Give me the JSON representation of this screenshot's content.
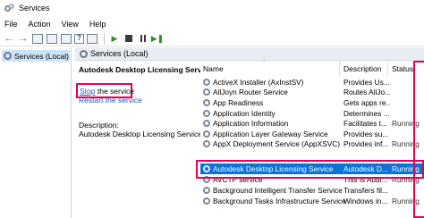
{
  "window": {
    "title": "Services"
  },
  "menu": [
    "File",
    "Action",
    "View",
    "Help"
  ],
  "tree": {
    "item": "Services (Local)"
  },
  "header": {
    "title": "Services (Local)"
  },
  "detail": {
    "service_title": "Autodesk Desktop Licensing Service",
    "stop_link": "Stop",
    "stop_suffix": " the service",
    "restart_link": "Restart the service",
    "desc_label": "Description:",
    "desc_text": "Autodesk Desktop Licensing Service"
  },
  "columns": {
    "name": "Name",
    "description": "Description",
    "status": "Status"
  },
  "rows": [
    {
      "name": "ActiveX Installer (AxInstSV)",
      "desc": "Provides Us...",
      "status": ""
    },
    {
      "name": "AllJoyn Router Service",
      "desc": "Routes AllJo...",
      "status": ""
    },
    {
      "name": "App Readiness",
      "desc": "Gets apps re...",
      "status": ""
    },
    {
      "name": "Application Identity",
      "desc": "Determines ...",
      "status": ""
    },
    {
      "name": "Application Information",
      "desc": "Facilitates t...",
      "status": "Running"
    },
    {
      "name": "Application Layer Gateway Service",
      "desc": "Provides su...",
      "status": ""
    },
    {
      "name": "AppX Deployment Service (AppXSVC)",
      "desc": "Provides inf...",
      "status": "Running"
    },
    {
      "name": "Autodesk Desktop Licensing Service",
      "desc": "Autodesk D...",
      "status": "Running"
    },
    {
      "name": "AVCTP service",
      "desc": "This is Audi...",
      "status": "Running"
    },
    {
      "name": "Background Intelligent Transfer Service",
      "desc": "Transfers fil...",
      "status": ""
    },
    {
      "name": "Background Tasks Infrastructure Service",
      "desc": "Windows in...",
      "status": "Running"
    }
  ],
  "selected_index": 7,
  "colors": {
    "accent": "#0a73d9",
    "highlight": "#e5005a",
    "link": "#1a56c7"
  }
}
